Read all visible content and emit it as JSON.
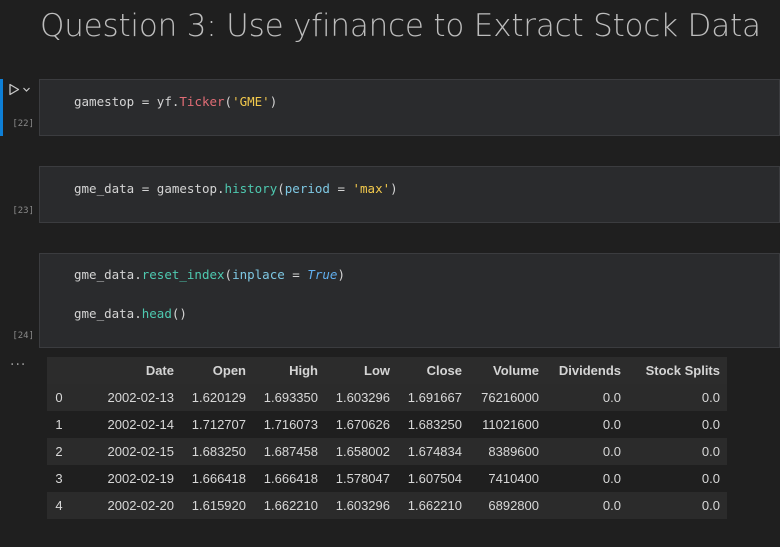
{
  "heading": "Question 3: Use yfinance to Extract Stock Data",
  "cells": [
    {
      "exec_count": "[22]",
      "lines": [
        [
          {
            "t": "gamestop",
            "c": "var"
          },
          {
            "t": " = ",
            "c": "op"
          },
          {
            "t": "yf",
            "c": "var"
          },
          {
            "t": ".",
            "c": "op"
          },
          {
            "t": "Ticker",
            "c": "attr"
          },
          {
            "t": "(",
            "c": "op"
          },
          {
            "t": "'GME'",
            "c": "str"
          },
          {
            "t": ")",
            "c": "op"
          }
        ]
      ]
    },
    {
      "exec_count": "[23]",
      "lines": [
        [
          {
            "t": "gme_data",
            "c": "var"
          },
          {
            "t": " = ",
            "c": "op"
          },
          {
            "t": "gamestop",
            "c": "var"
          },
          {
            "t": ".",
            "c": "op"
          },
          {
            "t": "history",
            "c": "fn"
          },
          {
            "t": "(",
            "c": "op"
          },
          {
            "t": "period",
            "c": "param"
          },
          {
            "t": " = ",
            "c": "op"
          },
          {
            "t": "'max'",
            "c": "str"
          },
          {
            "t": ")",
            "c": "op"
          }
        ]
      ]
    },
    {
      "exec_count": "[24]",
      "lines": [
        [
          {
            "t": "gme_data",
            "c": "var"
          },
          {
            "t": ".",
            "c": "op"
          },
          {
            "t": "reset_index",
            "c": "fn"
          },
          {
            "t": "(",
            "c": "op"
          },
          {
            "t": "inplace",
            "c": "param"
          },
          {
            "t": " = ",
            "c": "op"
          },
          {
            "t": "True",
            "c": "kw"
          },
          {
            "t": ")",
            "c": "op"
          }
        ],
        [
          {
            "t": "gme_data",
            "c": "var"
          },
          {
            "t": ".",
            "c": "op"
          },
          {
            "t": "head",
            "c": "fn"
          },
          {
            "t": "()",
            "c": "op"
          }
        ]
      ]
    }
  ],
  "output": {
    "dots": "···",
    "columns": [
      "",
      "Date",
      "Open",
      "High",
      "Low",
      "Close",
      "Volume",
      "Dividends",
      "Stock Splits"
    ],
    "rows": [
      [
        "0",
        "2002-02-13",
        "1.620129",
        "1.693350",
        "1.603296",
        "1.691667",
        "76216000",
        "0.0",
        "0.0"
      ],
      [
        "1",
        "2002-02-14",
        "1.712707",
        "1.716073",
        "1.670626",
        "1.683250",
        "11021600",
        "0.0",
        "0.0"
      ],
      [
        "2",
        "2002-02-15",
        "1.683250",
        "1.687458",
        "1.658002",
        "1.674834",
        "8389600",
        "0.0",
        "0.0"
      ],
      [
        "3",
        "2002-02-19",
        "1.666418",
        "1.666418",
        "1.578047",
        "1.607504",
        "7410400",
        "0.0",
        "0.0"
      ],
      [
        "4",
        "2002-02-20",
        "1.615920",
        "1.662210",
        "1.603296",
        "1.662210",
        "6892800",
        "0.0",
        "0.0"
      ]
    ]
  },
  "icons": {
    "run": "play-icon",
    "chevron": "chevron-down-icon"
  },
  "colors": {
    "accent": "#0e7fd6",
    "background": "#1f1f1f",
    "cell_background": "#2a2b2d"
  }
}
